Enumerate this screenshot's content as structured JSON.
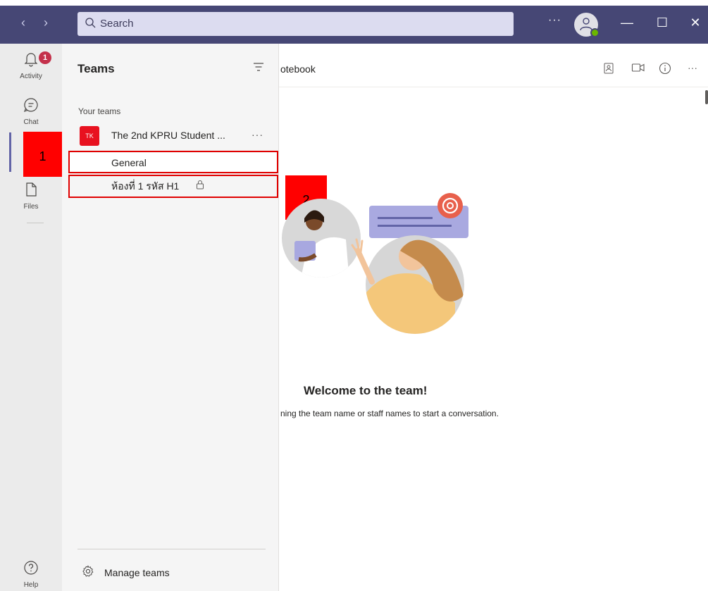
{
  "titlebar": {
    "back_icon": "chevron-left-icon",
    "forward_icon": "chevron-right-icon",
    "search_placeholder": "Search",
    "more_label": "···",
    "minimize_label": "—",
    "maximize_label": "☐",
    "close_label": "✕"
  },
  "rail": {
    "activity_label": "Activity",
    "activity_badge": "1",
    "chat_label": "Chat",
    "files_label": "Files",
    "help_label": "Help"
  },
  "teams_panel": {
    "title": "Teams",
    "section_label": "Your teams",
    "team": {
      "initials": "TK",
      "name": "The 2nd KPRU Student ...",
      "more_label": "···"
    },
    "channels": [
      {
        "label": "General"
      },
      {
        "label": "ห้องที่ 1 รหัส H1"
      }
    ],
    "manage_label": "Manage teams"
  },
  "annotations": [
    {
      "label": "1"
    },
    {
      "label": "2"
    }
  ],
  "main": {
    "tab_text": "otebook",
    "more_label": "···",
    "welcome_title": "Welcome to the team!",
    "welcome_sub": "ning the team name or staff names to start a conversation."
  },
  "colors": {
    "titlebar": "#464775",
    "accent": "#6264a7",
    "badge": "#c4314b",
    "team_tile": "#e8111f",
    "annotation": "#ff0000"
  }
}
